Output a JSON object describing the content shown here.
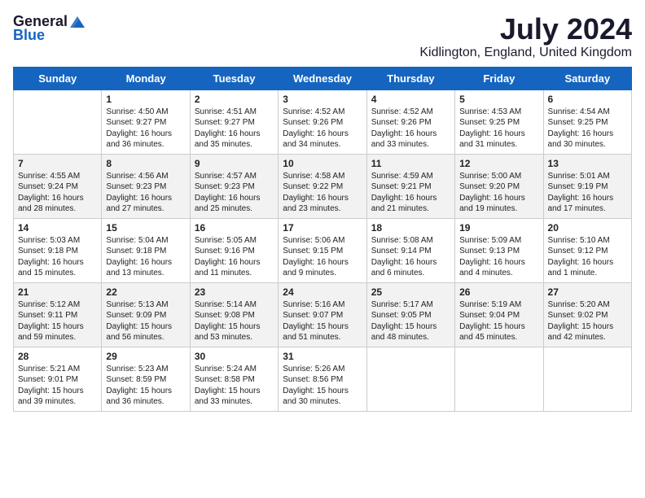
{
  "logo": {
    "general": "General",
    "blue": "Blue"
  },
  "title": {
    "month_year": "July 2024",
    "location": "Kidlington, England, United Kingdom"
  },
  "days_of_week": [
    "Sunday",
    "Monday",
    "Tuesday",
    "Wednesday",
    "Thursday",
    "Friday",
    "Saturday"
  ],
  "weeks": [
    [
      {
        "day": "",
        "info": ""
      },
      {
        "day": "1",
        "info": "Sunrise: 4:50 AM\nSunset: 9:27 PM\nDaylight: 16 hours\nand 36 minutes."
      },
      {
        "day": "2",
        "info": "Sunrise: 4:51 AM\nSunset: 9:27 PM\nDaylight: 16 hours\nand 35 minutes."
      },
      {
        "day": "3",
        "info": "Sunrise: 4:52 AM\nSunset: 9:26 PM\nDaylight: 16 hours\nand 34 minutes."
      },
      {
        "day": "4",
        "info": "Sunrise: 4:52 AM\nSunset: 9:26 PM\nDaylight: 16 hours\nand 33 minutes."
      },
      {
        "day": "5",
        "info": "Sunrise: 4:53 AM\nSunset: 9:25 PM\nDaylight: 16 hours\nand 31 minutes."
      },
      {
        "day": "6",
        "info": "Sunrise: 4:54 AM\nSunset: 9:25 PM\nDaylight: 16 hours\nand 30 minutes."
      }
    ],
    [
      {
        "day": "7",
        "info": "Sunrise: 4:55 AM\nSunset: 9:24 PM\nDaylight: 16 hours\nand 28 minutes."
      },
      {
        "day": "8",
        "info": "Sunrise: 4:56 AM\nSunset: 9:23 PM\nDaylight: 16 hours\nand 27 minutes."
      },
      {
        "day": "9",
        "info": "Sunrise: 4:57 AM\nSunset: 9:23 PM\nDaylight: 16 hours\nand 25 minutes."
      },
      {
        "day": "10",
        "info": "Sunrise: 4:58 AM\nSunset: 9:22 PM\nDaylight: 16 hours\nand 23 minutes."
      },
      {
        "day": "11",
        "info": "Sunrise: 4:59 AM\nSunset: 9:21 PM\nDaylight: 16 hours\nand 21 minutes."
      },
      {
        "day": "12",
        "info": "Sunrise: 5:00 AM\nSunset: 9:20 PM\nDaylight: 16 hours\nand 19 minutes."
      },
      {
        "day": "13",
        "info": "Sunrise: 5:01 AM\nSunset: 9:19 PM\nDaylight: 16 hours\nand 17 minutes."
      }
    ],
    [
      {
        "day": "14",
        "info": "Sunrise: 5:03 AM\nSunset: 9:18 PM\nDaylight: 16 hours\nand 15 minutes."
      },
      {
        "day": "15",
        "info": "Sunrise: 5:04 AM\nSunset: 9:18 PM\nDaylight: 16 hours\nand 13 minutes."
      },
      {
        "day": "16",
        "info": "Sunrise: 5:05 AM\nSunset: 9:16 PM\nDaylight: 16 hours\nand 11 minutes."
      },
      {
        "day": "17",
        "info": "Sunrise: 5:06 AM\nSunset: 9:15 PM\nDaylight: 16 hours\nand 9 minutes."
      },
      {
        "day": "18",
        "info": "Sunrise: 5:08 AM\nSunset: 9:14 PM\nDaylight: 16 hours\nand 6 minutes."
      },
      {
        "day": "19",
        "info": "Sunrise: 5:09 AM\nSunset: 9:13 PM\nDaylight: 16 hours\nand 4 minutes."
      },
      {
        "day": "20",
        "info": "Sunrise: 5:10 AM\nSunset: 9:12 PM\nDaylight: 16 hours\nand 1 minute."
      }
    ],
    [
      {
        "day": "21",
        "info": "Sunrise: 5:12 AM\nSunset: 9:11 PM\nDaylight: 15 hours\nand 59 minutes."
      },
      {
        "day": "22",
        "info": "Sunrise: 5:13 AM\nSunset: 9:09 PM\nDaylight: 15 hours\nand 56 minutes."
      },
      {
        "day": "23",
        "info": "Sunrise: 5:14 AM\nSunset: 9:08 PM\nDaylight: 15 hours\nand 53 minutes."
      },
      {
        "day": "24",
        "info": "Sunrise: 5:16 AM\nSunset: 9:07 PM\nDaylight: 15 hours\nand 51 minutes."
      },
      {
        "day": "25",
        "info": "Sunrise: 5:17 AM\nSunset: 9:05 PM\nDaylight: 15 hours\nand 48 minutes."
      },
      {
        "day": "26",
        "info": "Sunrise: 5:19 AM\nSunset: 9:04 PM\nDaylight: 15 hours\nand 45 minutes."
      },
      {
        "day": "27",
        "info": "Sunrise: 5:20 AM\nSunset: 9:02 PM\nDaylight: 15 hours\nand 42 minutes."
      }
    ],
    [
      {
        "day": "28",
        "info": "Sunrise: 5:21 AM\nSunset: 9:01 PM\nDaylight: 15 hours\nand 39 minutes."
      },
      {
        "day": "29",
        "info": "Sunrise: 5:23 AM\nSunset: 8:59 PM\nDaylight: 15 hours\nand 36 minutes."
      },
      {
        "day": "30",
        "info": "Sunrise: 5:24 AM\nSunset: 8:58 PM\nDaylight: 15 hours\nand 33 minutes."
      },
      {
        "day": "31",
        "info": "Sunrise: 5:26 AM\nSunset: 8:56 PM\nDaylight: 15 hours\nand 30 minutes."
      },
      {
        "day": "",
        "info": ""
      },
      {
        "day": "",
        "info": ""
      },
      {
        "day": "",
        "info": ""
      }
    ]
  ]
}
